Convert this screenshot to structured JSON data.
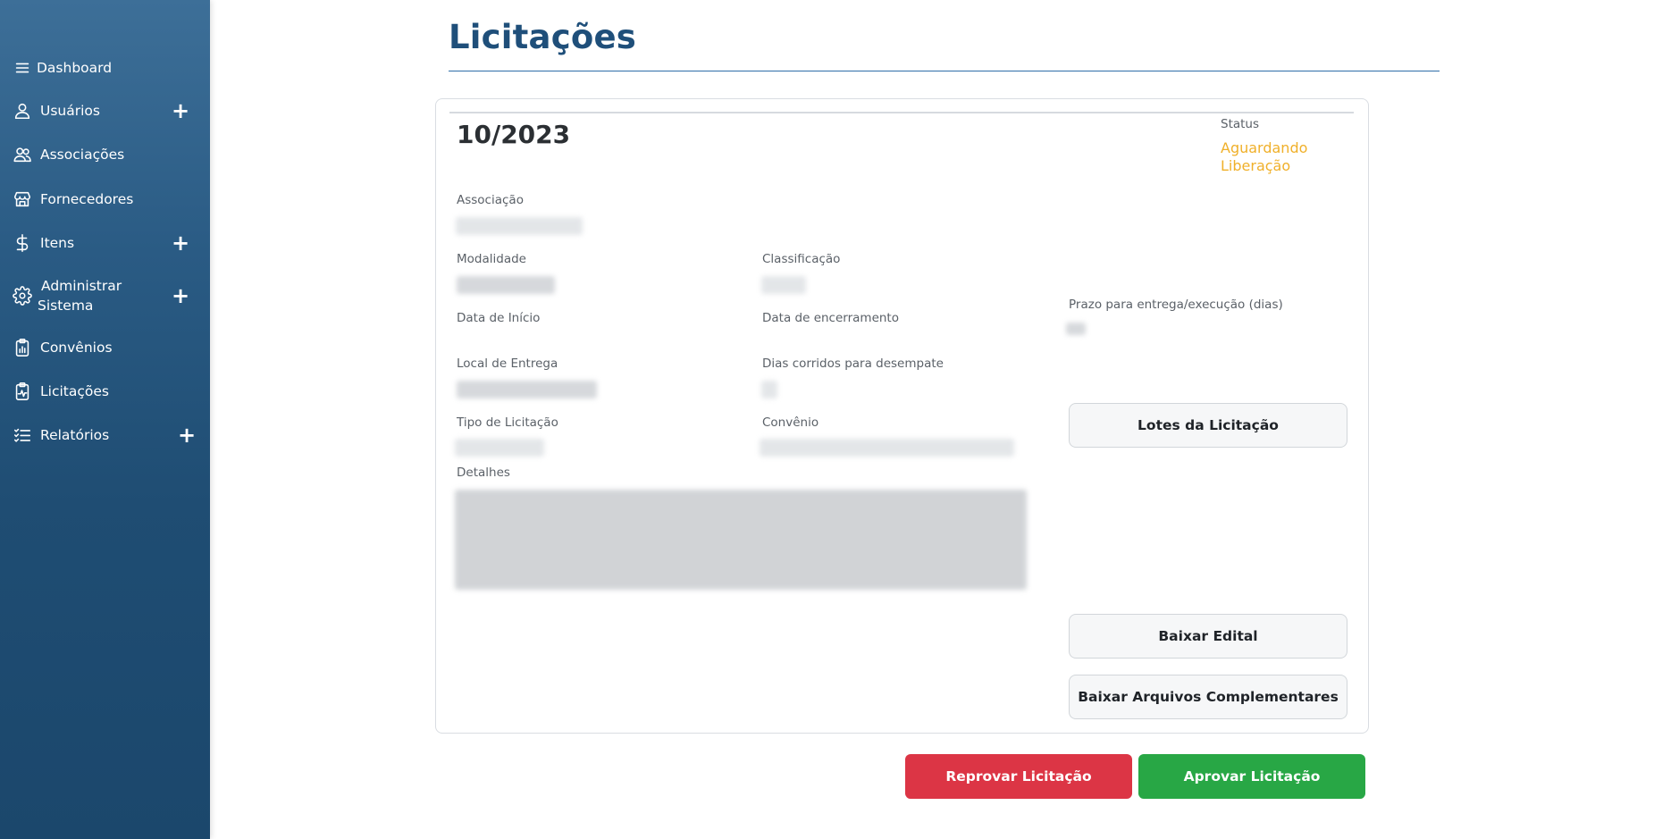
{
  "sidebar": {
    "items": [
      {
        "label": "Dashboard",
        "icon": "menu-icon",
        "expandable": false
      },
      {
        "label": "Usuários",
        "icon": "user-icon",
        "expandable": true
      },
      {
        "label": "Associações",
        "icon": "users-group-icon",
        "expandable": false
      },
      {
        "label": "Fornecedores",
        "icon": "store-icon",
        "expandable": false
      },
      {
        "label": "Itens",
        "icon": "dollar-icon",
        "expandable": true
      },
      {
        "label": "Administrar",
        "label2": "Sistema",
        "icon": "gear-icon",
        "expandable": true
      },
      {
        "label": "Convênios",
        "icon": "clipboard-chart-icon",
        "expandable": false
      },
      {
        "label": "Licitações",
        "icon": "clipboard-pulse-icon",
        "expandable": false
      },
      {
        "label": "Relatórios",
        "icon": "checklist-icon",
        "expandable": true
      }
    ],
    "plus_symbol": "+"
  },
  "page": {
    "title": "Licitações"
  },
  "licitacao": {
    "number": "10/2023",
    "status_label": "Status",
    "status_value": "Aguardando Liberação",
    "labels": {
      "associacao": "Associação",
      "modalidade": "Modalidade",
      "classificacao": "Classificação",
      "data_inicio": "Data de Início",
      "data_encerramento": "Data de encerramento",
      "prazo": "Prazo para entrega/execução (dias)",
      "local_entrega": "Local de Entrega",
      "dias_corridos": "Dias corridos para desempate",
      "tipo_licitacao": "Tipo de Licitação",
      "convenio": "Convênio",
      "detalhes": "Detalhes"
    },
    "buttons": {
      "lotes": "Lotes da Licitação",
      "baixar_edital": "Baixar Edital",
      "baixar_arquivos": "Baixar Arquivos Complementares"
    }
  },
  "actions": {
    "reprovar": "Reprovar Licitação",
    "aprovar": "Aprovar Licitação"
  },
  "colors": {
    "sidebar": "#24547c",
    "title": "#1f4f7a",
    "status": "#f0b02a",
    "reprovar": "#dc3545",
    "aprovar": "#28a745"
  }
}
